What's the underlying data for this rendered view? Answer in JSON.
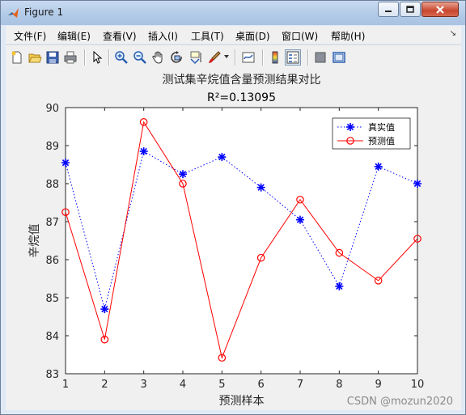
{
  "window": {
    "title": "Figure 1",
    "controls": [
      "minimize",
      "maximize",
      "close"
    ]
  },
  "menu": {
    "items": [
      "文件(F)",
      "编辑(E)",
      "查看(V)",
      "插入(I)",
      "工具(T)",
      "桌面(D)",
      "窗口(W)",
      "帮助(H)"
    ]
  },
  "toolbar": {
    "icons": [
      "new-figure-icon",
      "open-file-icon",
      "save-icon",
      "print-icon",
      "pointer-icon",
      "zoom-in-icon",
      "zoom-out-icon",
      "pan-icon",
      "rotate-3d-icon",
      "data-cursor-icon",
      "brush-icon",
      "link-plot-icon",
      "colorbar-icon",
      "legend-icon",
      "hide-plot-tools-icon",
      "show-plot-tools-icon"
    ]
  },
  "chart_data": {
    "type": "line",
    "title": "测试集辛烷值含量预测结果对比",
    "subtitle": "R²=0.13095",
    "xlabel": "预测样本",
    "ylabel": "辛烷值",
    "x": [
      1,
      2,
      3,
      4,
      5,
      6,
      7,
      8,
      9,
      10
    ],
    "xlim": [
      1,
      10
    ],
    "ylim": [
      83,
      90
    ],
    "xticks": [
      "1",
      "2",
      "3",
      "4",
      "5",
      "6",
      "7",
      "8",
      "9",
      "10"
    ],
    "yticks": [
      "83",
      "84",
      "85",
      "86",
      "87",
      "88",
      "89",
      "90"
    ],
    "grid": false,
    "legend_position": "top-right",
    "series": [
      {
        "name": "真实值",
        "color": "#0000ff",
        "line": "dotted",
        "marker": "asterisk",
        "values": [
          88.55,
          84.7,
          88.85,
          88.25,
          88.7,
          87.9,
          87.05,
          85.3,
          88.45,
          88.0
        ]
      },
      {
        "name": "预测值",
        "color": "#ff0000",
        "line": "solid",
        "marker": "circle",
        "values": [
          87.25,
          83.9,
          89.62,
          88.0,
          83.42,
          86.05,
          87.58,
          86.18,
          85.45,
          86.55
        ]
      }
    ]
  },
  "watermark": "CSDN @mozun2020"
}
